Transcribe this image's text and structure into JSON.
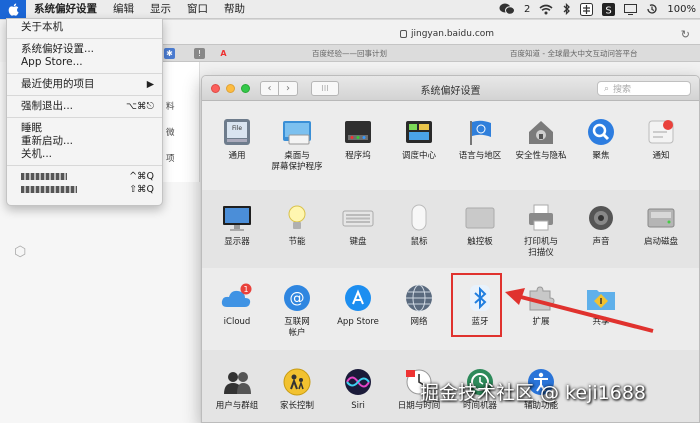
{
  "menubar": {
    "items": [
      "系统偏好设置",
      "编辑",
      "显示",
      "窗口",
      "帮助"
    ],
    "status": {
      "wechat_count": "2",
      "battery": "100%"
    }
  },
  "browser": {
    "url": "jingyan.baidu.com",
    "tabs": [
      "百度经验——回事计划",
      "百度知道 - 全球最大中文互动问答平台"
    ],
    "sidebar_fragments": [
      "料",
      "微",
      "项"
    ]
  },
  "apple_menu": {
    "about": "关于本机",
    "prefs": "系统偏好设置...",
    "app_store": "App Store...",
    "recent": "最近使用的项目",
    "force_quit": "强制退出...",
    "force_quit_shortcut": "⌥⌘⎋",
    "sleep": "睡眠",
    "restart": "重新启动...",
    "shutdown": "关机...",
    "lock_shortcut": "^⌘Q",
    "logout_shortcut": "⇧⌘Q"
  },
  "prefs": {
    "title": "系统偏好设置",
    "search_placeholder": "搜索",
    "row1": [
      "通用",
      "桌面与\n屏幕保护程序",
      "程序坞",
      "调度中心",
      "语言与地区",
      "安全性与隐私",
      "聚焦",
      "通知"
    ],
    "row2": [
      "显示器",
      "节能",
      "键盘",
      "鼠标",
      "触控板",
      "打印机与\n扫描仪",
      "声音",
      "启动磁盘"
    ],
    "row3": [
      "iCloud",
      "互联网\n帐户",
      "App Store",
      "网络",
      "蓝牙",
      "扩展",
      "共享"
    ],
    "row4": [
      "用户与群组",
      "家长控制",
      "Siri",
      "日期与时间",
      "时间机器",
      "辅助功能"
    ],
    "icloud_badge": "1"
  },
  "watermark": "掘金技术社区 @ keji1688",
  "colors": {
    "highlight": "#e0322e",
    "menu_accent": "#1b66d6"
  }
}
